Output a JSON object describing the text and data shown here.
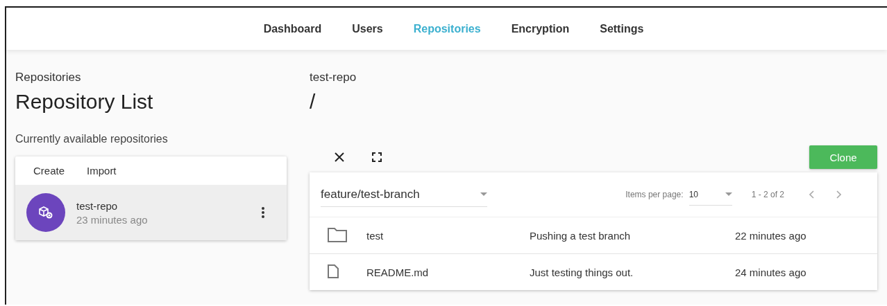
{
  "nav": {
    "tabs": [
      {
        "label": "Dashboard",
        "selected": false
      },
      {
        "label": "Users",
        "selected": false
      },
      {
        "label": "Repositories",
        "selected": true
      },
      {
        "label": "Encryption",
        "selected": false
      },
      {
        "label": "Settings",
        "selected": false
      }
    ]
  },
  "left": {
    "overline": "Repositories",
    "title": "Repository List",
    "subtitle": "Currently available repositories",
    "actions": [
      "Create",
      "Import"
    ],
    "repos": [
      {
        "name": "test-repo",
        "time": "23 minutes ago",
        "selected": true
      }
    ]
  },
  "right": {
    "overline": "test-repo",
    "path": "/",
    "clone": "Clone",
    "branch": "feature/test-branch",
    "items_label": "Items per page:",
    "items_value": "10",
    "range": "1 - 2 of 2",
    "files": [
      {
        "kind": "folder",
        "name": "test",
        "message": "Pushing a test branch",
        "time": "22 minutes ago"
      },
      {
        "kind": "file",
        "name": "README.md",
        "message": "Just testing things out.",
        "time": "24 minutes ago"
      }
    ]
  }
}
